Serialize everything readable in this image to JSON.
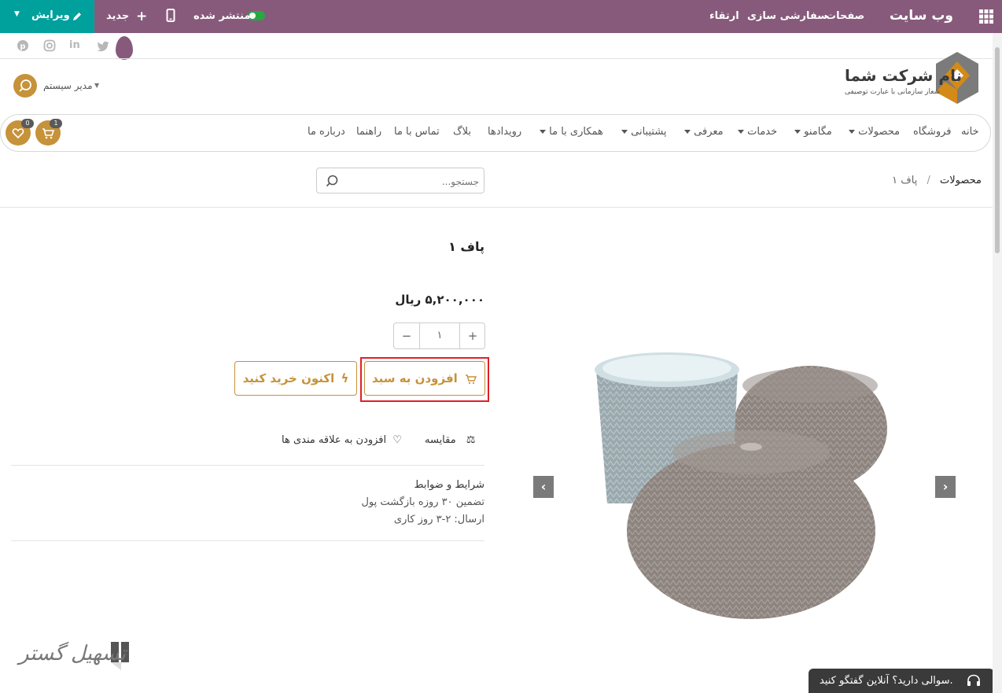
{
  "admin_bar": {
    "app_title": "وب سایت",
    "menu": [
      "صفحات",
      "سفارشی سازی",
      "ارتقاء"
    ],
    "published_label": "منتشر شده",
    "new_label": "جدید",
    "edit_label": "ویرایش",
    "color": "#875a7b",
    "edit_color": "#00a09d"
  },
  "header": {
    "company_name": "نام شرکت شما",
    "slogan": "شعار سازمانی با عبارت توصیفی",
    "user_name": "مدیر سیستم",
    "cart_count": "1",
    "wishlist_count": "0"
  },
  "nav": {
    "items": [
      {
        "label": "خانه"
      },
      {
        "label": "فروشگاه"
      },
      {
        "label": "محصولات"
      },
      {
        "label": "مگامنو"
      },
      {
        "label": "خدمات"
      },
      {
        "label": "معرفی"
      },
      {
        "label": "پشتیبانی"
      },
      {
        "label": "همکاری با ما"
      },
      {
        "label": "رویدادها"
      },
      {
        "label": "بلاگ"
      },
      {
        "label": "تماس با ما"
      },
      {
        "label": "راهنما"
      },
      {
        "label": "درباره ما"
      }
    ]
  },
  "breadcrumb": {
    "root": "محصولات",
    "separator": "/",
    "current": "پاف ۱"
  },
  "search": {
    "placeholder": "جستجو..."
  },
  "product": {
    "name": "پاف ۱",
    "price": "۵,۲۰۰,۰۰۰ ریال",
    "quantity": "۱",
    "add_to_cart": "افزودن به سبد",
    "buy_now": "اکنون خرید کنید",
    "compare": "مقایسه",
    "wishlist": "افزودن به علاقه مندی ها",
    "terms_title": "شرایط و ضوابط",
    "terms_line1": "تضمین ۳۰ روزه بازگشت پول",
    "terms_line2": "ارسال: ۲-۳ روز کاری",
    "accent_color": "#c6923a"
  },
  "chat": {
    "label": "سوالی دارید؟ آنلاین گفتگو کنید."
  },
  "watermark": {
    "text": "تسهیل گستر"
  }
}
